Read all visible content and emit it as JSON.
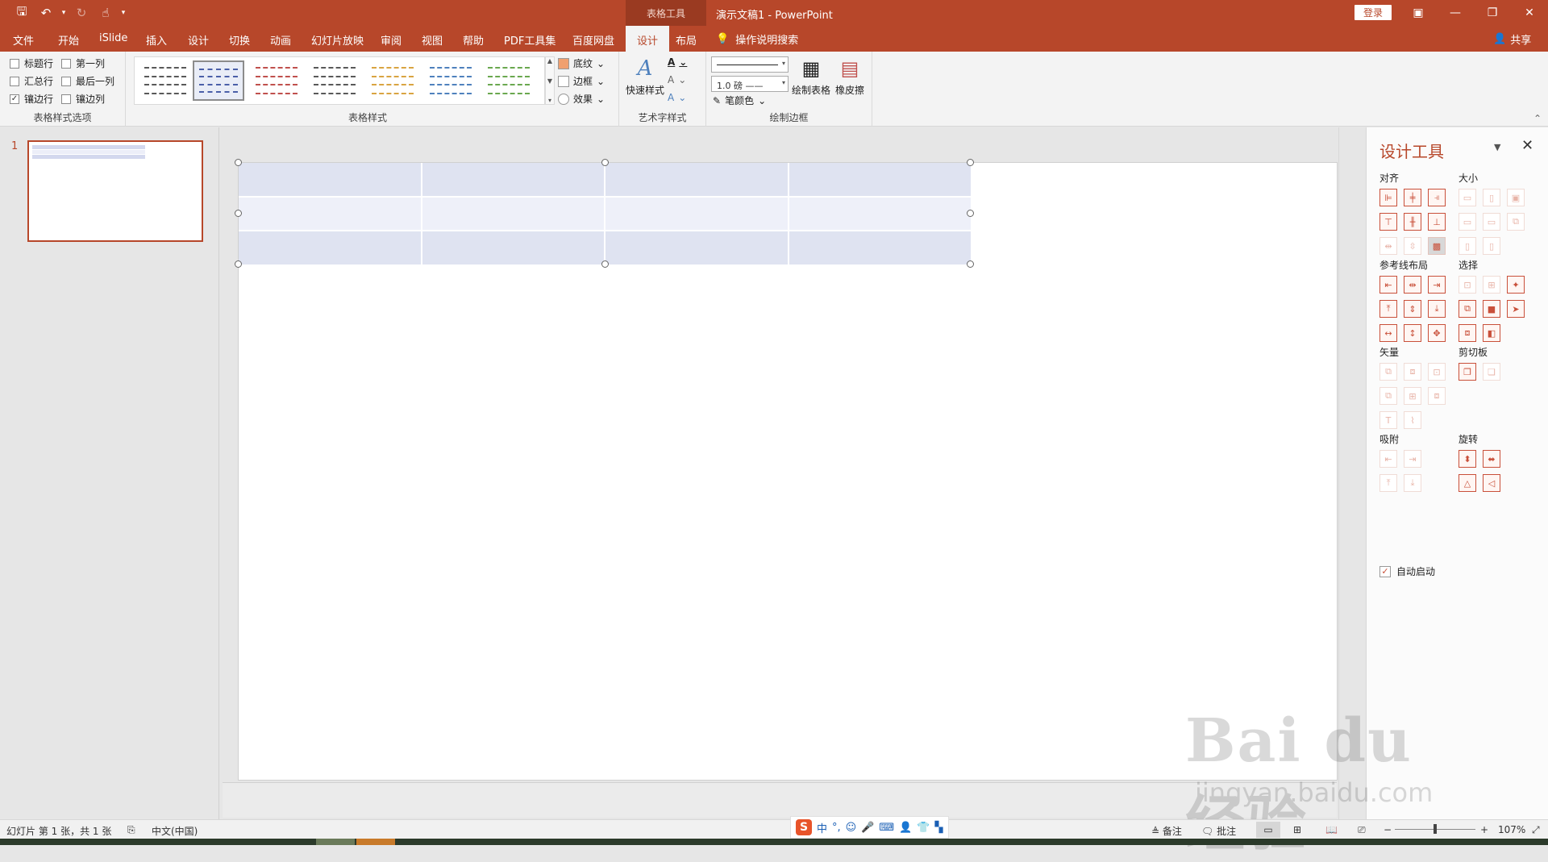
{
  "titlebar": {
    "context_tools": "表格工具",
    "doc_title": "演示文稿1  -  PowerPoint",
    "login": "登录",
    "icons": {
      "save": "save-icon",
      "undo": "undo-icon",
      "redo": "redo-icon",
      "touch": "touch-mode-icon",
      "customize": "customize-qat-icon"
    },
    "win": {
      "ribbon_opts": "▣",
      "minimize": "—",
      "restore": "❐",
      "close": "✕"
    }
  },
  "tabs": [
    {
      "label": "文件"
    },
    {
      "label": "开始"
    },
    {
      "label": "iSlide"
    },
    {
      "label": "插入"
    },
    {
      "label": "设计"
    },
    {
      "label": "切换"
    },
    {
      "label": "动画"
    },
    {
      "label": "幻灯片放映"
    },
    {
      "label": "审阅"
    },
    {
      "label": "视图"
    },
    {
      "label": "帮助"
    },
    {
      "label": "PDF工具集"
    },
    {
      "label": "百度网盘"
    },
    {
      "label": "设计"
    },
    {
      "label": "布局"
    }
  ],
  "tell_me": "操作说明搜索",
  "share": "共享",
  "ribbon": {
    "options": {
      "label": "表格样式选项",
      "items": [
        {
          "label": "标题行",
          "checked": false
        },
        {
          "label": "第一列",
          "checked": false
        },
        {
          "label": "汇总行",
          "checked": false
        },
        {
          "label": "最后一列",
          "checked": false
        },
        {
          "label": "镶边行",
          "checked": true
        },
        {
          "label": "镶边列",
          "checked": false
        }
      ]
    },
    "styles": {
      "label": "表格样式",
      "swatch_colors": [
        "#595959",
        "#4a5fa8",
        "#c0504d",
        "#595959",
        "#d9a441",
        "#4f81bd",
        "#6aa84f"
      ],
      "shading": "底纹",
      "borders": "边框",
      "effects": "效果"
    },
    "wordart": {
      "label": "艺术字样式",
      "quick": "快速样式"
    },
    "draw": {
      "label": "绘制边框",
      "pen_weight": "1.0 磅",
      "pen_color": "笔颜色",
      "draw_table": "绘制表格",
      "eraser": "橡皮擦"
    }
  },
  "slides": {
    "number": "1"
  },
  "design_tools": {
    "title": "设计工具",
    "sections": {
      "align": "对齐",
      "size": "大小",
      "guides": "参考线布局",
      "select": "选择",
      "vector": "矢量",
      "clipboard": "剪切板",
      "snap": "吸附",
      "rotate": "旋转"
    },
    "auto_start": "自动启动"
  },
  "status": {
    "slide_info": "幻灯片 第 1 张，共 1 张",
    "language": "中文(中国)",
    "notes": "备注",
    "comments": "批注",
    "zoom": "107%"
  },
  "ime": {
    "logo": "S",
    "mode": "中"
  },
  "watermark": {
    "brand": "Bai du 经验",
    "url": "jingyan.baidu.com"
  }
}
